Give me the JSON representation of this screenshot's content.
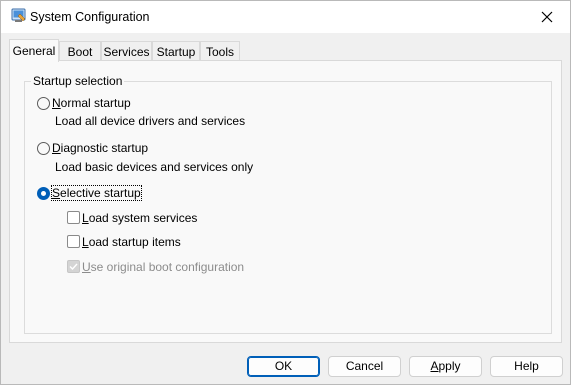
{
  "window": {
    "title": "System Configuration",
    "app_icon": "msconfig-icon",
    "close_icon": "close-icon"
  },
  "tabs": [
    {
      "label": "General",
      "active": true
    },
    {
      "label": "Boot",
      "active": false
    },
    {
      "label": "Services",
      "active": false
    },
    {
      "label": "Startup",
      "active": false
    },
    {
      "label": "Tools",
      "active": false
    }
  ],
  "startup_selection": {
    "legend": "Startup selection",
    "options": [
      {
        "label_underlined": "N",
        "label_rest": "ormal startup",
        "description": "Load all device drivers and services",
        "selected": false
      },
      {
        "label_underlined": "D",
        "label_rest": "iagnostic startup",
        "description": "Load basic devices and services only",
        "selected": false
      },
      {
        "label_underlined": "S",
        "label_rest": "elective startup",
        "description": "",
        "selected": true
      }
    ],
    "selective_items": [
      {
        "label_underlined": "L",
        "label_rest": "oad system services",
        "checked": false,
        "disabled": false
      },
      {
        "label_underlined": "L",
        "label_rest": "oad startup items",
        "checked": false,
        "disabled": false
      },
      {
        "label_underlined": "U",
        "label_rest": "se original boot configuration",
        "checked": true,
        "disabled": true
      }
    ]
  },
  "buttons": {
    "ok": "OK",
    "cancel": "Cancel",
    "apply_underlined": "A",
    "apply_rest": "pply",
    "help": "Help"
  },
  "colors": {
    "accent": "#005fb8",
    "window_bg": "#f0f0f0",
    "panel_bg": "#f9f9f9"
  }
}
